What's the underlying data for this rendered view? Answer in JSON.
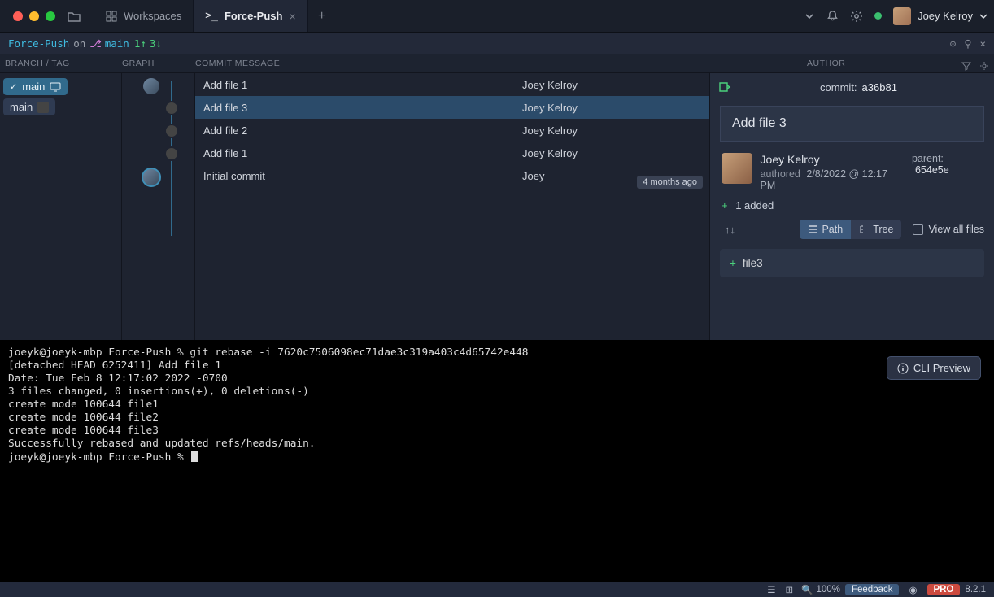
{
  "titlebar": {
    "workspaces_label": "Workspaces",
    "active_tab": "Force-Push",
    "user_name": "Joey Kelroy"
  },
  "repo": {
    "name": "Force-Push",
    "on_label": "on",
    "branch_glyph": "⎇",
    "branch": "main",
    "ahead": "1↑",
    "behind": "3↓"
  },
  "columns": {
    "branch": "BRANCH / TAG",
    "graph": "GRAPH",
    "message": "COMMIT MESSAGE",
    "author": "AUTHOR"
  },
  "branches": {
    "local": {
      "check": "✓",
      "name": "main"
    },
    "remote": {
      "name": "main"
    }
  },
  "commits": [
    {
      "message": "Add file 1",
      "author": "Joey Kelroy",
      "selected": false
    },
    {
      "message": "Add file 3",
      "author": "Joey Kelroy",
      "selected": true
    },
    {
      "message": "Add file 2",
      "author": "Joey Kelroy",
      "selected": false
    },
    {
      "message": "Add file 1",
      "author": "Joey Kelroy",
      "selected": false
    },
    {
      "message": "Initial commit",
      "author": "Joey",
      "selected": false
    }
  ],
  "time_badge": "4 months ago",
  "detail": {
    "header_prefix": "commit:",
    "sha": "a36b81",
    "title": "Add file 3",
    "author": "Joey Kelroy",
    "authored_label": "authored",
    "date": "2/8/2022 @ 12:17 PM",
    "parent_label": "parent:",
    "parent_sha": "654e5e",
    "changes_plus": "+",
    "changes_text": "1 added",
    "path_label": "Path",
    "tree_label": "Tree",
    "viewall_label": "View all files",
    "file_plus": "+",
    "file_name": "file3"
  },
  "terminal_lines": [
    "joeyk@joeyk-mbp Force-Push % git rebase -i 7620c7506098ec71dae3c319a403c4d65742e448",
    "[detached HEAD 6252411] Add file 1",
    " Date: Tue Feb 8 12:17:02 2022 -0700",
    " 3 files changed, 0 insertions(+), 0 deletions(-)",
    " create mode 100644 file1",
    " create mode 100644 file2",
    " create mode 100644 file3",
    "Successfully rebased and updated refs/heads/main.",
    "joeyk@joeyk-mbp Force-Push % "
  ],
  "cli_btn": "CLI Preview",
  "footer": {
    "zoom": "100%",
    "feedback": "Feedback",
    "pro": "PRO",
    "version": "8.2.1"
  }
}
